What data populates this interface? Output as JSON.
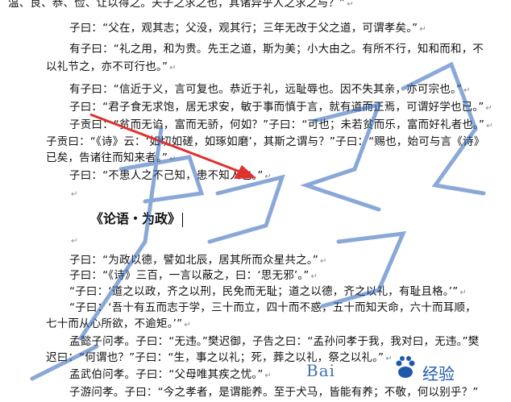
{
  "lines": [
    "温、良、恭、俭、让以得之。夫子之求之也，其诸异乎人之求之与？”",
    "子曰：“父在，观其志；父没，观其行；三年无改于父之道，可谓孝矣。”",
    "有子曰：“礼之用，和为贵。先王之道，斯为美；小大由之。有所不行，知和而和，不",
    "以礼节之，亦不可行也。”",
    "有子曰：“信近于义，言可复也。恭近于礼，远耻辱也。因不失其亲，亦可宗也。”",
    "子曰：“君子食无求饱，居无求安，敏于事而慎于言，就有道而正焉，可谓好学也已。”",
    "子贡曰：“贫而无谄，富而无骄，何如？”子曰：“可也；未若贫而乐，富而好礼者也。”",
    "子贡曰：“《诗》云：‘如切如磋，如琢如磨’，其斯之谓与？”子曰：“赐也，始可与言《诗》",
    "已矣，告诸往而知来者。”",
    "子曰：“不患人之不己知，患不知人也。”",
    "子曰：“为政以德，譬如北辰，居其所而众星共之。”",
    "子曰：“《诗》三百，一言以蔽之，曰：‘思无邪’。”",
    "“子曰：‘道之以政，齐之以刑，民免而无耻；道之以德，齐之以礼，有耻且格。’”",
    "“子曰：‘吾十有五而志于学，三十而立，四十而不惑，五十而知天命，六十而耳顺，",
    "七十而从心所欲，不逾矩。’”",
    "孟懿子问孝。子曰：“无违。”樊迟御，子告之曰：“孟孙问孝于我，我对曰，无违。”樊",
    "迟曰：“何谓也？”子曰：“生，事之以礼；死，葬之以礼，祭之以礼。”",
    "孟武伯问孝。子曰：“父母唯其疾之忧。”",
    "子游问孝。子曰：“今之孝者，是谓能养。至于犬马，皆能有养；不敬，何以别乎？”"
  ],
  "heading": "《论语・为政》",
  "para_mark": "↵",
  "watermark": {
    "text": "Bai",
    "sub": "经验"
  },
  "colors": {
    "arrow": "#e03030",
    "watermark_stroke": "#2a62b8"
  }
}
